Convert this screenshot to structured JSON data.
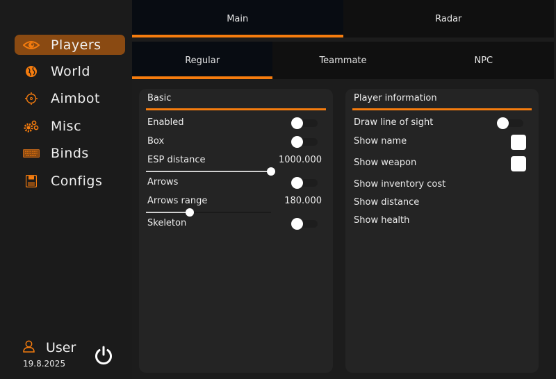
{
  "accent": "#f57c0e",
  "sidebar": {
    "items": [
      {
        "label": "Players",
        "icon": "eye-icon",
        "active": true
      },
      {
        "label": "World",
        "icon": "globe-icon",
        "active": false
      },
      {
        "label": "Aimbot",
        "icon": "crosshair-icon",
        "active": false
      },
      {
        "label": "Misc",
        "icon": "gears-icon",
        "active": false
      },
      {
        "label": "Binds",
        "icon": "keyboard-icon",
        "active": false
      },
      {
        "label": "Configs",
        "icon": "floppy-disk-icon",
        "active": false
      }
    ],
    "user": {
      "name": "User",
      "date": "19.8.2025"
    }
  },
  "tabs": {
    "main": [
      {
        "label": "Main",
        "active": true
      },
      {
        "label": "Radar",
        "active": false
      }
    ],
    "sub": [
      {
        "label": "Regular",
        "active": true
      },
      {
        "label": "Teammate",
        "active": false
      },
      {
        "label": "NPC",
        "active": false
      }
    ]
  },
  "basic": {
    "title": "Basic",
    "enabled": {
      "label": "Enabled",
      "on": false
    },
    "box": {
      "label": "Box",
      "on": false
    },
    "esp_distance": {
      "label": "ESP distance",
      "value": "1000.000",
      "fraction": 1.0
    },
    "arrows": {
      "label": "Arrows",
      "on": false
    },
    "arrows_range": {
      "label": "Arrows range",
      "value": "180.000",
      "fraction": 0.35
    },
    "skeleton": {
      "label": "Skeleton",
      "on": false
    }
  },
  "player_info": {
    "title": "Player information",
    "line_of_sight": {
      "label": "Draw line of sight",
      "on": false
    },
    "show_name": {
      "label": "Show name",
      "checked": false
    },
    "show_weapon": {
      "label": "Show weapon",
      "checked": false
    },
    "show_inventory_cost": {
      "label": "Show inventory cost"
    },
    "show_distance": {
      "label": "Show distance"
    },
    "show_health": {
      "label": "Show health"
    }
  }
}
